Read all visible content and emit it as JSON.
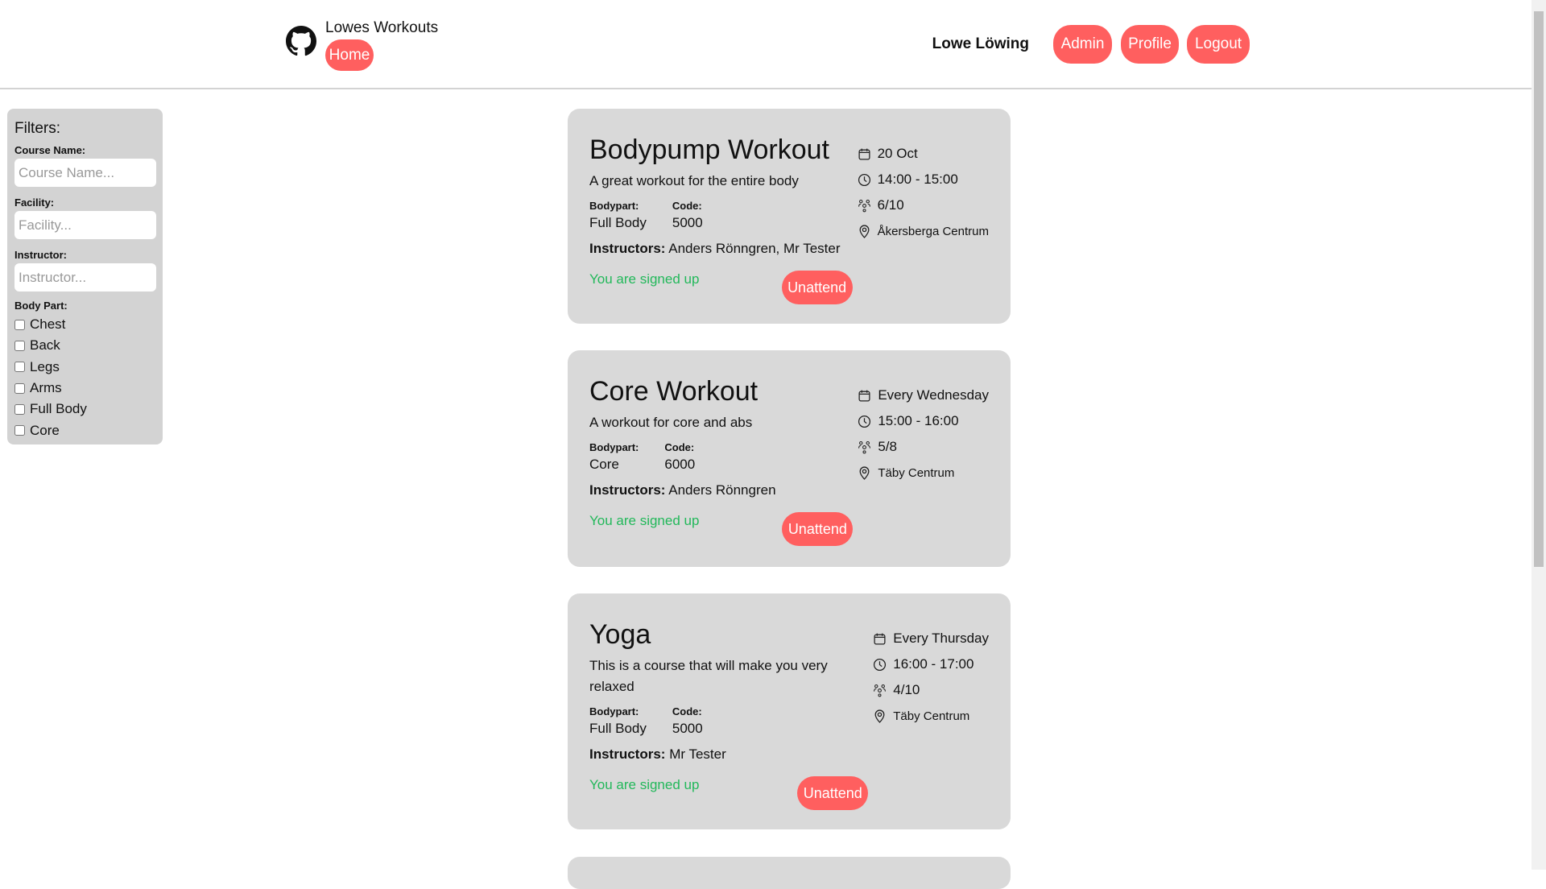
{
  "header": {
    "brand": "Lowes Workouts",
    "home": "Home",
    "user": "Lowe Löwing",
    "admin": "Admin",
    "profile": "Profile",
    "logout": "Logout"
  },
  "filters": {
    "title": "Filters:",
    "course_label": "Course Name:",
    "course_placeholder": "Course Name...",
    "facility_label": "Facility:",
    "facility_placeholder": "Facility...",
    "instructor_label": "Instructor:",
    "instructor_placeholder": "Instructor...",
    "bodypart_label": "Body Part:",
    "bodyparts": [
      "Chest",
      "Back",
      "Legs",
      "Arms",
      "Full Body",
      "Core"
    ]
  },
  "labels": {
    "bodypart": "Bodypart:",
    "code": "Code:",
    "instructors": "Instructors:",
    "signed": "You are signed up",
    "unattend": "Unattend"
  },
  "courses": [
    {
      "title": "Bodypump Workout",
      "desc": "A great workout for the entire body",
      "bodypart": "Full Body",
      "code": "5000",
      "instructors": "Anders Rönngren, Mr Tester",
      "date": "20 Oct",
      "time": "14:00 - 15:00",
      "attendance": "6/10",
      "location": "Åkersberga Centrum"
    },
    {
      "title": "Core Workout",
      "desc": "A workout for core and abs",
      "bodypart": "Core",
      "code": "6000",
      "instructors": "Anders Rönngren",
      "date": "Every Wednesday",
      "time": "15:00 - 16:00",
      "attendance": "5/8",
      "location": "Täby Centrum"
    },
    {
      "title": "Yoga",
      "desc": "This is a course that will make you very relaxed",
      "bodypart": "Full Body",
      "code": "5000",
      "instructors": "Mr Tester",
      "date": "Every Thursday",
      "time": "16:00 - 17:00",
      "attendance": "4/10",
      "location": "Täby Centrum"
    }
  ]
}
